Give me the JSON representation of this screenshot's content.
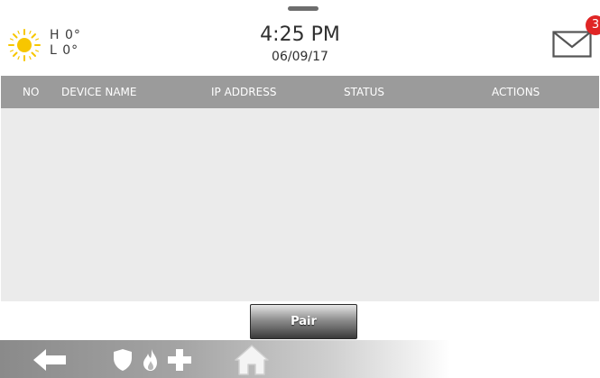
{
  "header": {
    "weather": {
      "icon": "sun-icon",
      "high": "H 0°",
      "low": "L 0°"
    },
    "time": "4:25 PM",
    "date": "06/09/17",
    "messages": {
      "icon": "envelope-icon",
      "count": "3",
      "badge_color": "#e02525"
    }
  },
  "table": {
    "columns": [
      "NO",
      "DEVICE NAME",
      "IP ADDRESS",
      "STATUS",
      "ACTIONS"
    ],
    "rows": []
  },
  "actions": {
    "pair_label": "Pair"
  },
  "bottom_bar": {
    "items": [
      {
        "name": "back",
        "icon": "back-arrow-icon"
      },
      {
        "name": "police",
        "icon": "shield-icon"
      },
      {
        "name": "fire",
        "icon": "fire-icon"
      },
      {
        "name": "medical",
        "icon": "medical-cross-icon"
      },
      {
        "name": "home",
        "icon": "home-icon"
      }
    ]
  },
  "colors": {
    "header_bg": "#ffffff",
    "table_header_bg": "#9b9b9b",
    "table_body_bg": "#ebebeb",
    "sun": "#f7c600"
  }
}
